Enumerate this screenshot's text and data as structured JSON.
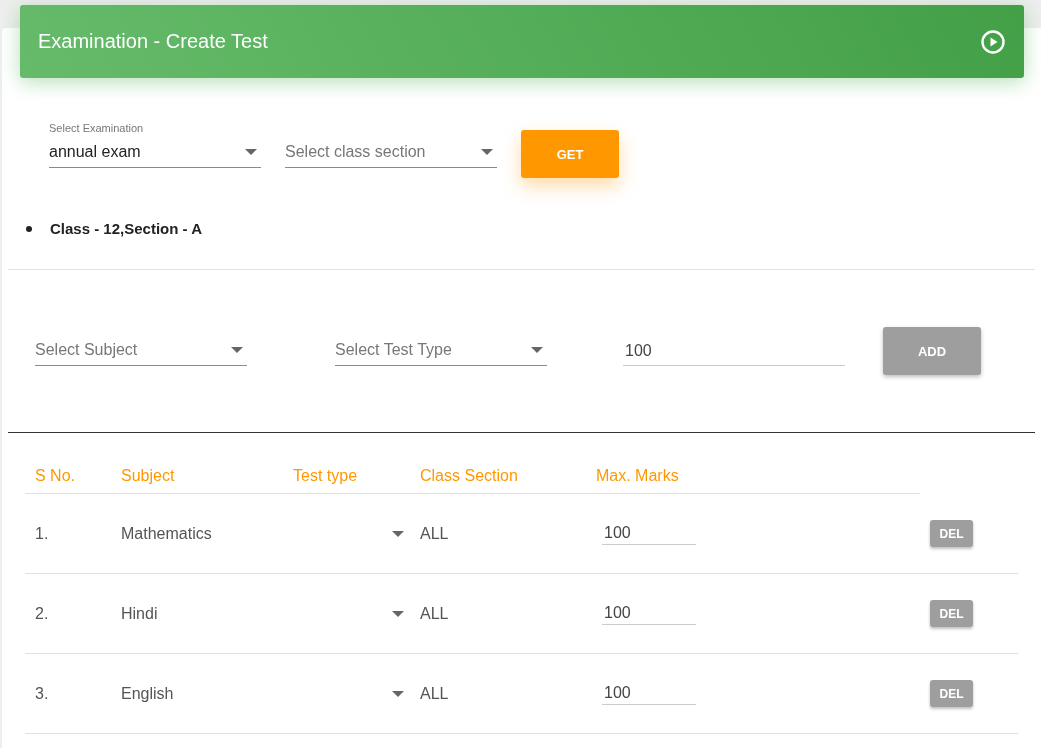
{
  "header": {
    "title": "Examination - Create Test"
  },
  "filters": {
    "examination": {
      "label": "Select Examination",
      "value": "annual exam"
    },
    "class_section": {
      "placeholder": "Select class section"
    },
    "button": "GET"
  },
  "selected_classes": [
    "Class - 12,Section - A"
  ],
  "add_form": {
    "subject": {
      "placeholder": "Select Subject"
    },
    "test_type": {
      "placeholder": "Select Test Type"
    },
    "max_marks": {
      "value": "100"
    },
    "button": "ADD",
    "button_disabled": true
  },
  "table": {
    "columns": [
      "S No.",
      "Subject",
      "Test type",
      "Class Section",
      "Max. Marks"
    ],
    "rows": [
      {
        "sno": "1.",
        "subject": "Mathematics",
        "class_section": "ALL",
        "max_marks": "100",
        "action": "DEL"
      },
      {
        "sno": "2.",
        "subject": "Hindi",
        "class_section": "ALL",
        "max_marks": "100",
        "action": "DEL"
      },
      {
        "sno": "3.",
        "subject": "English",
        "class_section": "ALL",
        "max_marks": "100",
        "action": "DEL"
      }
    ]
  }
}
